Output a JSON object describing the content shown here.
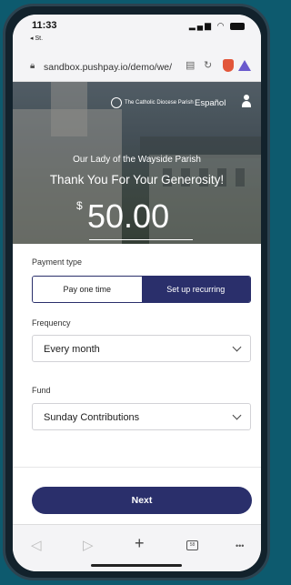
{
  "status_bar": {
    "time": "11:33",
    "back_app": "◂ St.",
    "signal_icon": "signal-icon",
    "wifi_icon": "wifi-icon",
    "battery_icon": "battery-icon"
  },
  "browser": {
    "url": "sandbox.pushpay.io/demo/we/",
    "lock_icon": "lock-icon",
    "reader_icon": "reader-icon",
    "reload_icon": "reload-icon",
    "brave_shield_color": "#e2563a",
    "rewards_color": "#6a5acd"
  },
  "hero": {
    "logo_text": "The Catholic Diocese Parish",
    "language_link": "Español",
    "parish_name": "Our Lady of the Wayside Parish",
    "thanks": "Thank You For Your Generosity!",
    "currency": "$",
    "amount": "50.00"
  },
  "form": {
    "payment_type_label": "Payment type",
    "payment_options": [
      "Pay one time",
      "Set up recurring"
    ],
    "payment_selected": "Set up recurring",
    "frequency_label": "Frequency",
    "frequency_value": "Every month",
    "fund_label": "Fund",
    "fund_value": "Sunday Contributions",
    "next_label": "Next",
    "accent_color": "#2a2f6b"
  },
  "toolbar": {
    "back": "◁",
    "forward": "▷",
    "new_tab": "+",
    "tabs_count": "58",
    "more": "•••"
  }
}
